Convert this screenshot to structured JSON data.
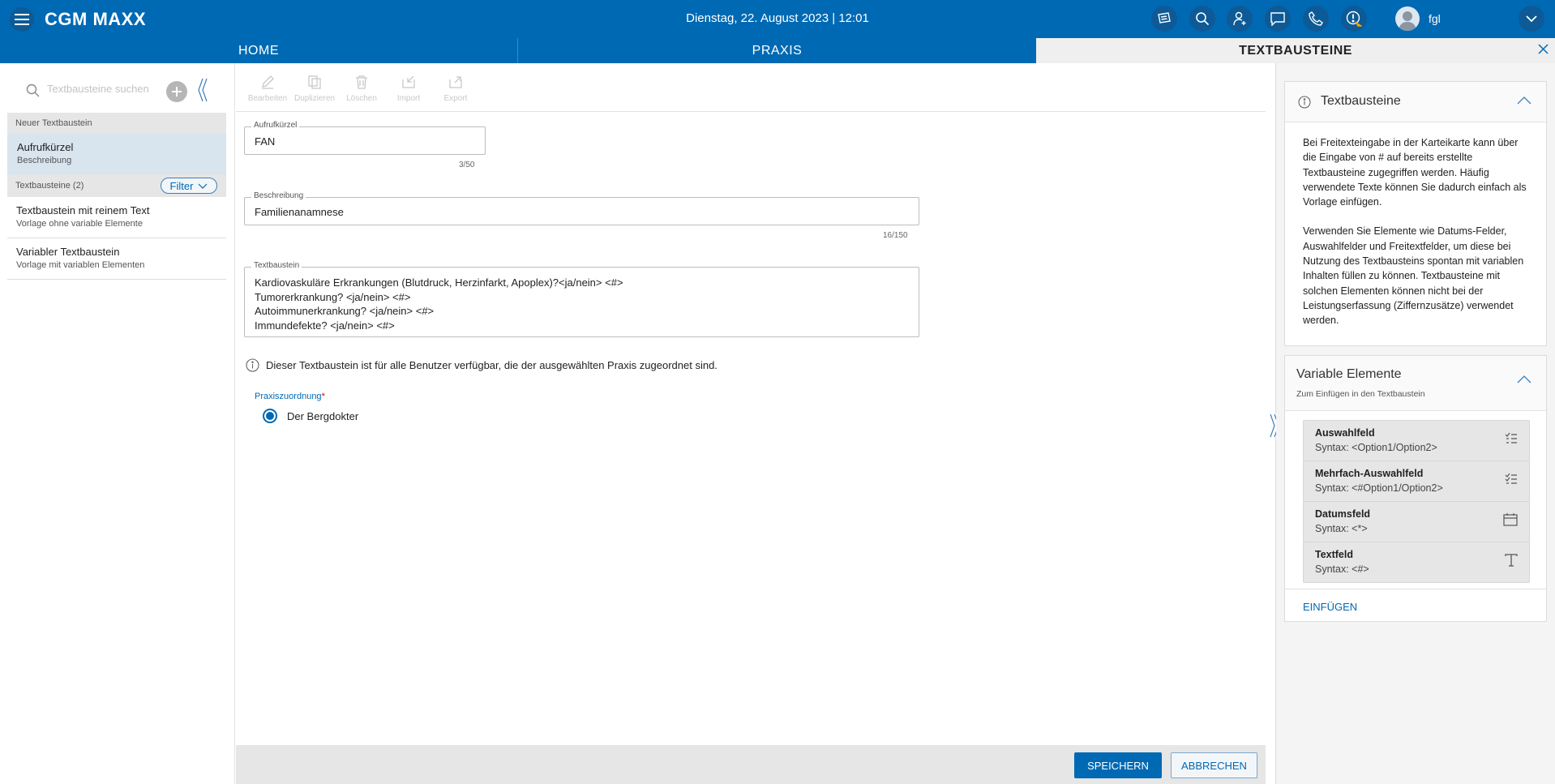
{
  "header": {
    "logo": "CGM MAXX",
    "datetime": "Dienstag, 22. August 2023 | 12:01",
    "username": "fgl"
  },
  "tabs": [
    {
      "label": "HOME"
    },
    {
      "label": "PRAXIS"
    },
    {
      "label": "TEXTBAUSTEINE"
    }
  ],
  "sidebar": {
    "search_placeholder": "Textbausteine suchen",
    "new_section": "Neuer Textbaustein",
    "new_item": {
      "title": "Aufrufkürzel",
      "subtitle": "Beschreibung"
    },
    "list_section": "Textbausteine (2)",
    "filter_label": "Filter",
    "items": [
      {
        "title": "Textbaustein mit reinem Text",
        "subtitle": "Vorlage ohne variable Elemente"
      },
      {
        "title": "Variabler Textbaustein",
        "subtitle": "Vorlage mit variablen Elementen"
      }
    ]
  },
  "toolbar": {
    "edit": "Bearbeiten",
    "duplicate": "Duplizieren",
    "delete": "Löschen",
    "import": "Import",
    "export": "Export"
  },
  "form": {
    "shortcut": {
      "label": "Aufrufkürzel",
      "value": "FAN",
      "counter": "3/50"
    },
    "description": {
      "label": "Beschreibung",
      "value": "Familienanamnese",
      "counter": "16/150"
    },
    "textbaustein": {
      "label": "Textbaustein",
      "lines": [
        "Kardiovaskuläre Erkrankungen (Blutdruck, Herzinfarkt, Apoplex)?<ja/nein> <#>",
        "Tumorerkrankung? <ja/nein> <#>",
        "Autoimmunerkrankung? <ja/nein> <#>",
        "Immundefekte? <ja/nein> <#>"
      ]
    },
    "info_text": "Dieser Textbaustein ist für alle Benutzer verfügbar, die der ausgewählten Praxis zugeordnet sind.",
    "praxis_label": "Praxiszuordnung",
    "praxis_required": "*",
    "praxis_option": "Der Bergdokter"
  },
  "footer": {
    "save": "SPEICHERN",
    "cancel": "ABBRECHEN"
  },
  "info_card": {
    "title": "Textbausteine",
    "paragraphs": [
      "Bei Freitexteingabe in der Karteikarte kann über die Eingabe von # auf bereits erstellte Textbausteine zugegriffen werden. Häufig verwendete Texte können Sie dadurch einfach als Vorlage einfügen.",
      "Verwenden Sie Elemente wie Datums-Felder, Auswahlfelder und Freitextfelder, um diese bei Nutzung des Textbausteins spontan mit variablen Inhalten füllen zu können. Textbausteine mit solchen Elementen können nicht bei der Leistungserfassung (Ziffernzusätze) verwendet werden."
    ]
  },
  "variables_card": {
    "title": "Variable Elemente",
    "subtitle": "Zum Einfügen in den Textbaustein",
    "items": [
      {
        "title": "Auswahlfeld",
        "syntax": "Syntax: <Option1/Option2>",
        "icon": "single-select-list-icon"
      },
      {
        "title": "Mehrfach-Auswahlfeld",
        "syntax": "Syntax: <#Option1/Option2>",
        "icon": "multi-select-list-icon"
      },
      {
        "title": "Datumsfeld",
        "syntax": "Syntax: <*>",
        "icon": "calendar-icon"
      },
      {
        "title": "Textfeld",
        "syntax": "Syntax: <#>",
        "icon": "text-icon"
      }
    ],
    "insert": "EINFÜGEN"
  },
  "colors": {
    "brand_blue": "#0069b4",
    "topbar_icon_bg": "#0d5a96",
    "selected_item_bg": "#d8e4ee"
  }
}
